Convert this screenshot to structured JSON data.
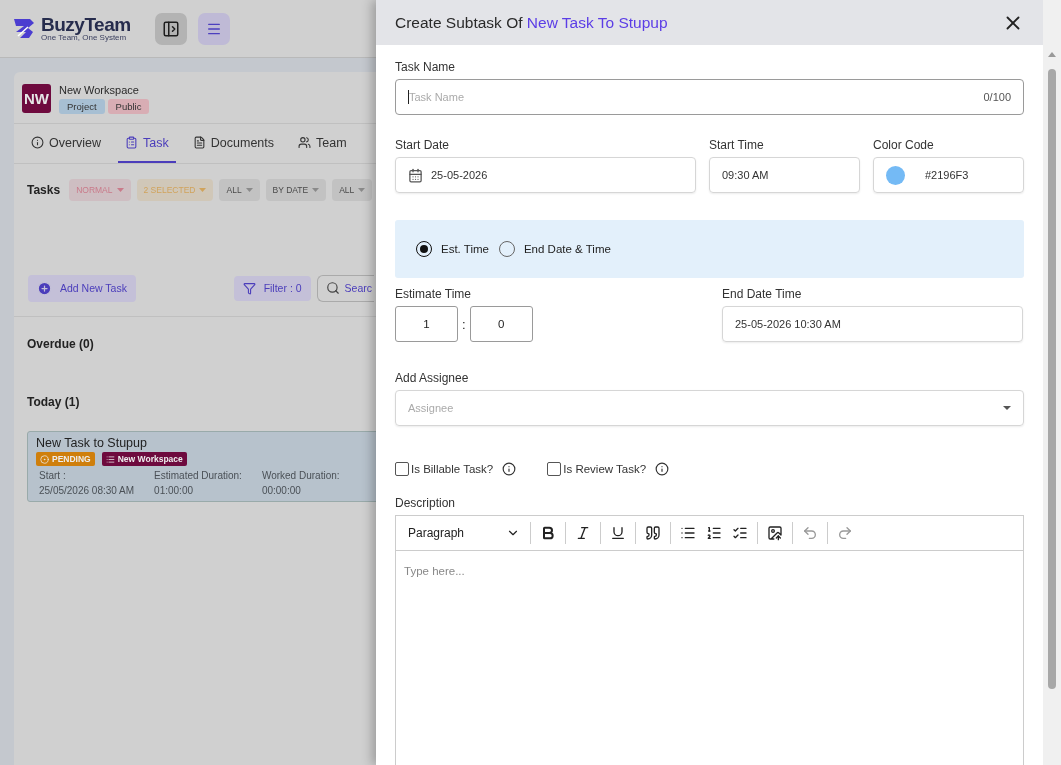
{
  "header": {
    "logo": {
      "name": "BuzyTeam",
      "tagline": "One Team, One System"
    }
  },
  "workspace": {
    "initials": "NW",
    "name": "New Workspace",
    "tags": [
      {
        "label": "Project",
        "color": "#a7bfd3"
      },
      {
        "label": "Public",
        "color": "#d8adb4"
      }
    ]
  },
  "tabs": [
    {
      "label": "Overview",
      "kind": "info",
      "selected": false
    },
    {
      "label": "Task",
      "kind": "task",
      "selected": true
    },
    {
      "label": "Documents",
      "kind": "doc",
      "selected": false
    },
    {
      "label": "Team",
      "kind": "team",
      "selected": false
    }
  ],
  "tasks_toolbar": {
    "title": "Tasks",
    "filters": [
      {
        "label": "NORMAL",
        "color": "#c97a8a"
      },
      {
        "label": "2 SELECTED",
        "color": "#d0a35c"
      },
      {
        "label": "ALL",
        "color": "#8a8a8a"
      },
      {
        "label": "BY DATE",
        "color": "#8a8a8a"
      },
      {
        "label": "ALL",
        "color": "#8a8a8a"
      }
    ]
  },
  "actions": {
    "add_button": "Add New Task",
    "filter_button": "Filter : 0",
    "search_placeholder": "Searc"
  },
  "sections": [
    {
      "title": "Overdue (0)"
    },
    {
      "title": "Today (1)",
      "tasks": [
        {
          "title": "New Task to Stupup",
          "status": "PENDING",
          "workspace": "New Workspace",
          "fields": [
            {
              "label": "Start :",
              "value": "25/05/2026 08:30 AM"
            },
            {
              "label": "Estimated Duration:",
              "value": "01:00:00"
            },
            {
              "label": "Worked Duration:",
              "value": "00:00:00"
            }
          ]
        }
      ]
    }
  ],
  "drawer": {
    "title": "Create Subtask Of ",
    "title_highlight": "New Task To Stupup",
    "task_name": {
      "label": "Task Name",
      "placeholder": "Task Name",
      "counter": "0/100"
    },
    "start_date": {
      "label": "Start Date",
      "value": "25-05-2026"
    },
    "start_time": {
      "label": "Start Time",
      "value": "09:30 AM"
    },
    "color_code": {
      "label": "Color Code",
      "value": "#2196F3",
      "color": "#74baf5"
    },
    "mode_options": [
      {
        "label": "Est. Time",
        "selected": true
      },
      {
        "label": "End Date & Time",
        "selected": false
      }
    ],
    "estimate_time": {
      "label": "Estimate Time",
      "hours": "1",
      "separator": ":",
      "minutes": "0"
    },
    "end_date_time": {
      "label": "End Date Time",
      "value": "25-05-2026 10:30 AM"
    },
    "assignee": {
      "label": "Add Assignee",
      "placeholder": "Assignee"
    },
    "checkboxes": [
      {
        "label": "Is Billable Task?",
        "checked": false
      },
      {
        "label": "Is Review Task?",
        "checked": false
      }
    ],
    "description": {
      "label": "Description",
      "block_style": "Paragraph",
      "placeholder": "Type here...",
      "tools": [
        {
          "kind": "bold",
          "disabled": false
        },
        {
          "kind": "italic",
          "disabled": false
        },
        {
          "kind": "underline",
          "disabled": false
        },
        {
          "kind": "quote",
          "disabled": false
        },
        {
          "kind": "bullets",
          "disabled": false
        },
        {
          "kind": "numbers",
          "disabled": false
        },
        {
          "kind": "todo",
          "disabled": false
        },
        {
          "kind": "image",
          "disabled": false
        },
        {
          "kind": "undo",
          "disabled": true
        },
        {
          "kind": "redo",
          "disabled": true
        }
      ]
    }
  }
}
